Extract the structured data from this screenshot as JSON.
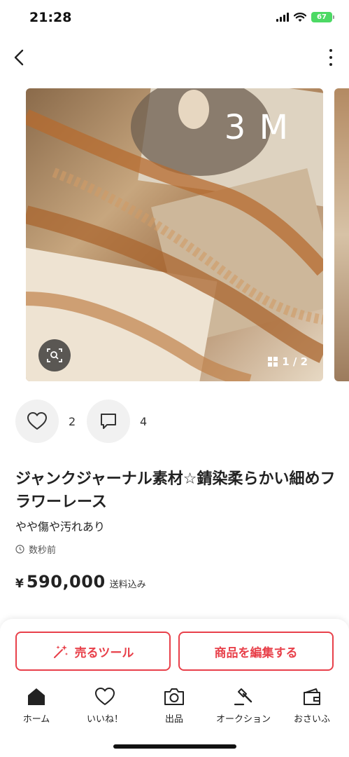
{
  "status_bar": {
    "time": "21:28",
    "battery": "67"
  },
  "photo": {
    "overlay_text": "3 M",
    "page_indicator": "1 / 2"
  },
  "actions": {
    "likes": "2",
    "comments": "4"
  },
  "item": {
    "title": "ジャンクジャーナル素材☆錆染柔らかい細めフラワーレース",
    "condition": "やや傷や汚れあり",
    "time_ago": "数秒前",
    "price_currency": "¥",
    "price": "590,000",
    "shipping": "送料込み"
  },
  "buttons": {
    "sell_tools": "売るツール",
    "edit_item": "商品を編集する"
  },
  "tabs": [
    {
      "label": "ホーム"
    },
    {
      "label": "いいね！"
    },
    {
      "label": "出品"
    },
    {
      "label": "オークション"
    },
    {
      "label": "おさいふ"
    }
  ],
  "colors": {
    "accent": "#e8404a",
    "battery_green": "#4cd964"
  }
}
